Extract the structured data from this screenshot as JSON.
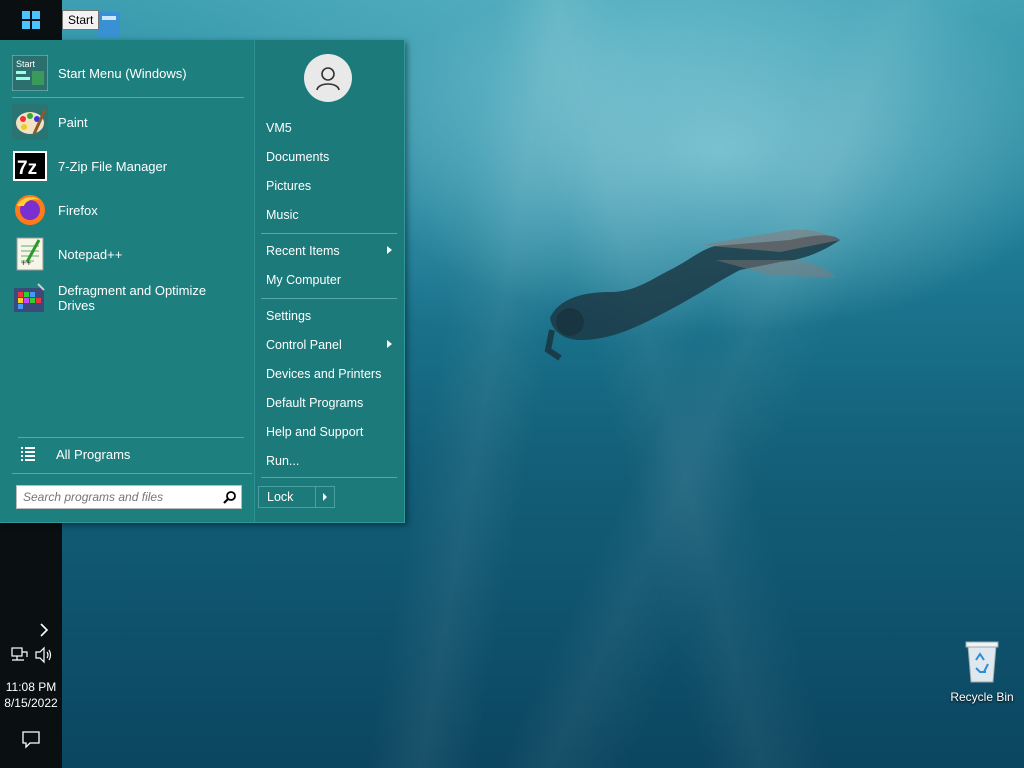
{
  "taskbar": {
    "start_tooltip": "Start",
    "clock_time": "11:08 PM",
    "clock_date": "8/15/2022"
  },
  "start_menu": {
    "pinned": [
      {
        "label": "Start Menu (Windows)",
        "icon": "start-menu-app-icon"
      },
      {
        "label": "Paint",
        "icon": "paint-palette-icon"
      },
      {
        "label": "7-Zip File Manager",
        "icon": "7zip-icon"
      },
      {
        "label": "Firefox",
        "icon": "firefox-icon"
      },
      {
        "label": "Notepad++",
        "icon": "notepadpp-icon"
      },
      {
        "label": "Defragment and Optimize Drives",
        "icon": "defrag-icon"
      }
    ],
    "all_programs": "All Programs",
    "search_placeholder": "Search programs and files",
    "right": {
      "items": [
        {
          "label": "VM5"
        },
        {
          "label": "Documents"
        },
        {
          "label": "Pictures"
        },
        {
          "label": "Music"
        },
        {
          "label": "Recent Items",
          "submenu": true
        },
        {
          "label": "My Computer"
        },
        {
          "label": "Settings"
        },
        {
          "label": "Control Panel",
          "submenu": true
        },
        {
          "label": "Devices and Printers"
        },
        {
          "label": "Default Programs"
        },
        {
          "label": "Help and Support"
        },
        {
          "label": "Run..."
        }
      ],
      "lock_label": "Lock"
    }
  },
  "desktop": {
    "recycle_bin_label": "Recycle Bin"
  },
  "colors": {
    "menu_bg": "#1e7f7f",
    "taskbar_bg": "#0a0f12",
    "accent": "#2f9898"
  }
}
